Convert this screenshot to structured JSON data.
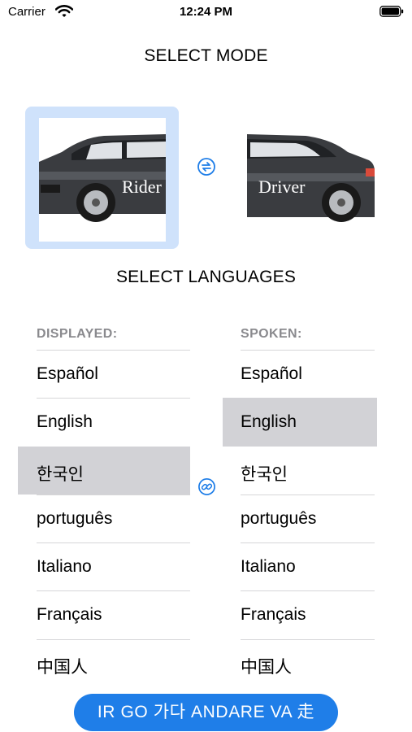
{
  "status_bar": {
    "carrier": "Carrier",
    "time": "12:24 PM"
  },
  "mode": {
    "title": "SELECT MODE",
    "rider_label": "Rider",
    "driver_label": "Driver",
    "selected": "Rider"
  },
  "languages": {
    "title": "SELECT LANGUAGES",
    "displayed": {
      "header": "DISPLAYED:",
      "items": [
        "Español",
        "English",
        "한국인",
        "português",
        "Italiano",
        "Français",
        "中国人"
      ],
      "selected": "한국인"
    },
    "spoken": {
      "header": "SPOKEN:",
      "items": [
        "Español",
        "English",
        "한국인",
        "português",
        "Italiano",
        "Français",
        "中国人"
      ],
      "selected": "English"
    }
  },
  "go_button": {
    "label": "IR  GO  가다  ANDARE  VA  走"
  },
  "colors": {
    "accent": "#1f7ee8",
    "selected_card": "#cfe2fb",
    "selected_row": "#d2d2d6"
  }
}
